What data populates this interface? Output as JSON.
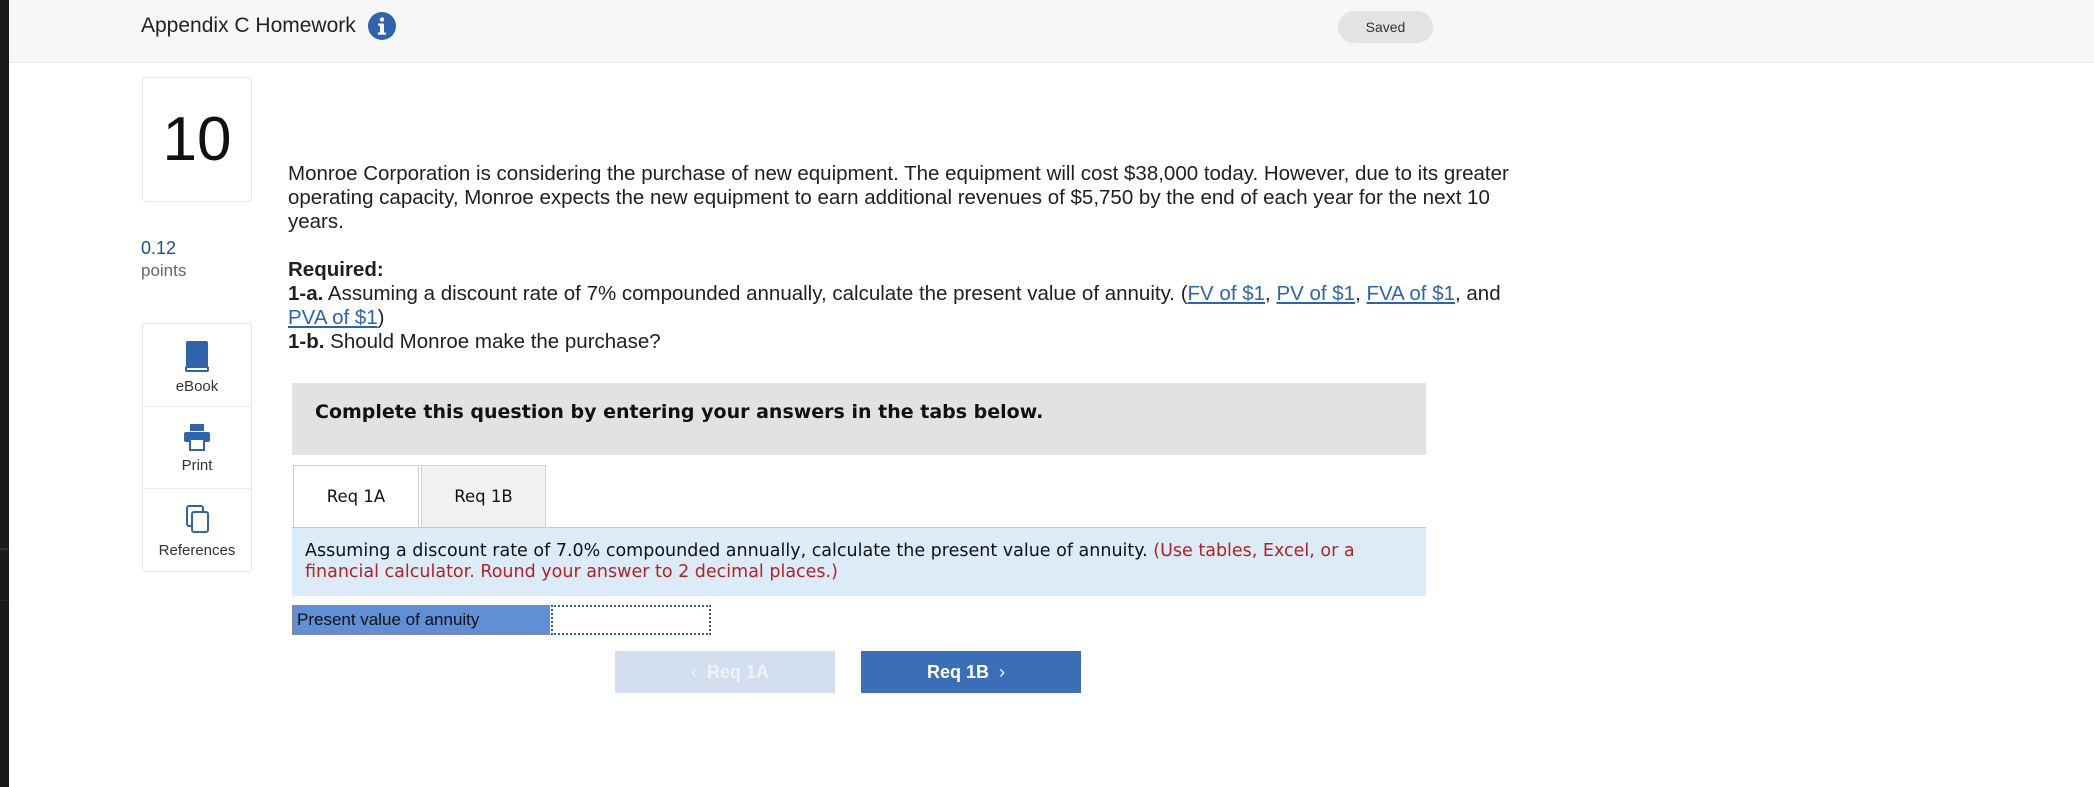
{
  "header": {
    "title": "Appendix C Homework",
    "saved_status": "Saved"
  },
  "question": {
    "number": "10",
    "points_value": "0.12",
    "points_label": "points",
    "intro": "Monroe Corporation is considering the purchase of new equipment. The equipment will cost $38,000 today. However, due to its greater operating capacity, Monroe expects the new equipment to earn additional revenues of $5,750 by the end of each year for the next 10 years.",
    "required_heading": "Required:",
    "req_1a_prefix": "1-a.",
    "req_1a_text": "Assuming a discount rate of 7% compounded annually, calculate the present value of annuity. (",
    "links": [
      "FV of $1",
      "PV of $1",
      "FVA of $1",
      "PVA of $1"
    ],
    "link_sep_1": ",",
    "link_sep_2": ",",
    "link_sep_3": ", and",
    "link_close": ")",
    "req_1b_prefix": "1-b.",
    "req_1b_text": "Should Monroe make the purchase?"
  },
  "tools": {
    "ebook": "eBook",
    "print": "Print",
    "references": "References"
  },
  "instructions": "Complete this question by entering your answers in the tabs below.",
  "tabs": [
    "Req 1A",
    "Req 1B"
  ],
  "req_panel": {
    "text": "Assuming a discount rate of 7.0% compounded annually, calculate the present value of annuity.",
    "hint": "(Use tables, Excel, or a financial calculator. Round your answer to 2 decimal places.)"
  },
  "answer": {
    "label": "Present value of annuity",
    "value": ""
  },
  "nav": {
    "prev_label": "Req 1A",
    "next_label": "Req 1B"
  },
  "colors": {
    "accent": "#3a6fb8",
    "link": "#2c64b1",
    "hint_red": "#b22222",
    "panel_blue": "#dcebf8"
  }
}
